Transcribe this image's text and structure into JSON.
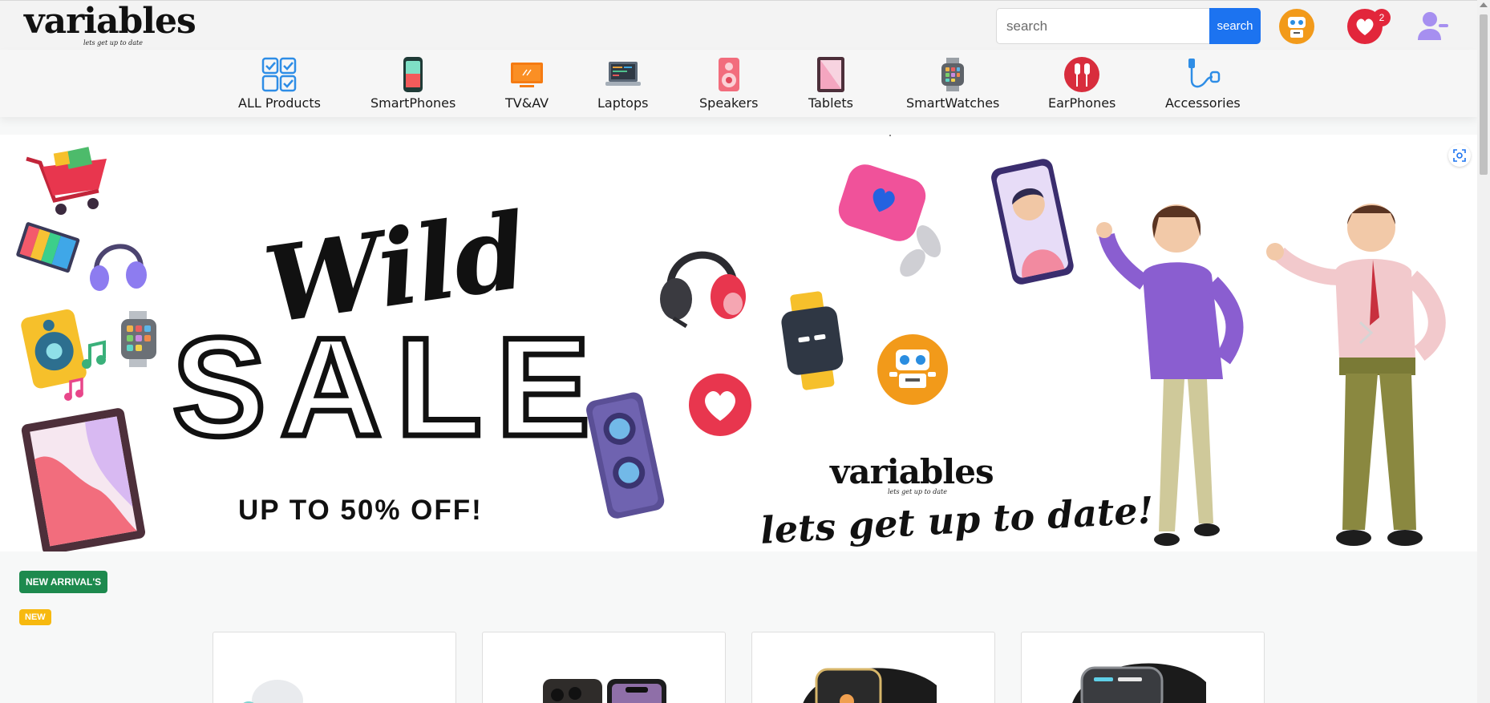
{
  "header": {
    "logo_text": "variables",
    "logo_tagline": "lets get up to date",
    "search_placeholder": "search",
    "search_button_label": "search",
    "wishlist_count": "2"
  },
  "categories": [
    {
      "label": "ALL Products",
      "icon": "grid-checklist-icon"
    },
    {
      "label": "SmartPhones",
      "icon": "smartphone-icon"
    },
    {
      "label": "TV&AV",
      "icon": "tv-icon"
    },
    {
      "label": "Laptops",
      "icon": "laptop-icon"
    },
    {
      "label": "Speakers",
      "icon": "speaker-icon"
    },
    {
      "label": "Tablets",
      "icon": "tablet-icon"
    },
    {
      "label": "SmartWatches",
      "icon": "smartwatch-icon"
    },
    {
      "label": "EarPhones",
      "icon": "earphones-icon"
    },
    {
      "label": "Accessories",
      "icon": "cable-accessory-icon"
    }
  ],
  "hero": {
    "headline_script": "Wild",
    "headline_big": "SALE",
    "offer": "UP TO 50% OFF!",
    "brand": "variables",
    "brand_tagline": "lets get up to date",
    "slogan": "lets get up to date!"
  },
  "tags": {
    "new_arrivals": "NEW ARRIVAL'S",
    "new": "NEW"
  },
  "colors": {
    "accent": "#1c73f0",
    "badge": "#e2263b",
    "tag_green": "#1d8a4e",
    "tag_yellow": "#f7b90f"
  }
}
